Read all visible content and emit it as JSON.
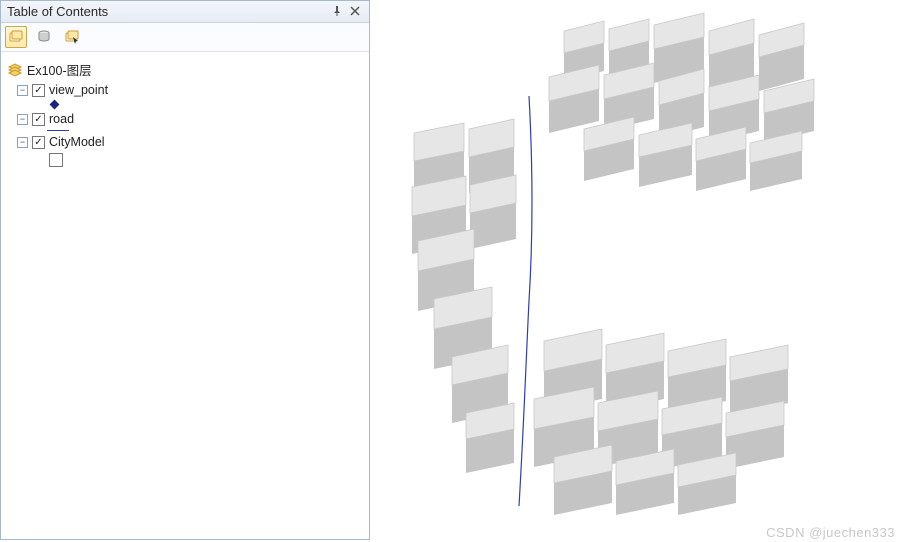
{
  "panel": {
    "title": "Table of Contents",
    "pin_tooltip": "Auto Hide",
    "close_tooltip": "Close",
    "toolbar": {
      "list_by_drawing_order": "List By Drawing Order",
      "list_by_source": "List By Source",
      "list_by_selection": "List By Selection"
    }
  },
  "tree": {
    "root_label": "Ex100-图层",
    "layers": [
      {
        "expanded": true,
        "checked": true,
        "name": "view_point",
        "symbol": "point"
      },
      {
        "expanded": true,
        "checked": true,
        "name": "road",
        "symbol": "line"
      },
      {
        "expanded": true,
        "checked": true,
        "name": "CityModel",
        "symbol": "polygon"
      }
    ]
  },
  "watermark": "CSDN @juechen333",
  "colors": {
    "road": "#2d3eaf",
    "building_top": "#e6e6e6",
    "building_side": "#c4c4c4"
  }
}
